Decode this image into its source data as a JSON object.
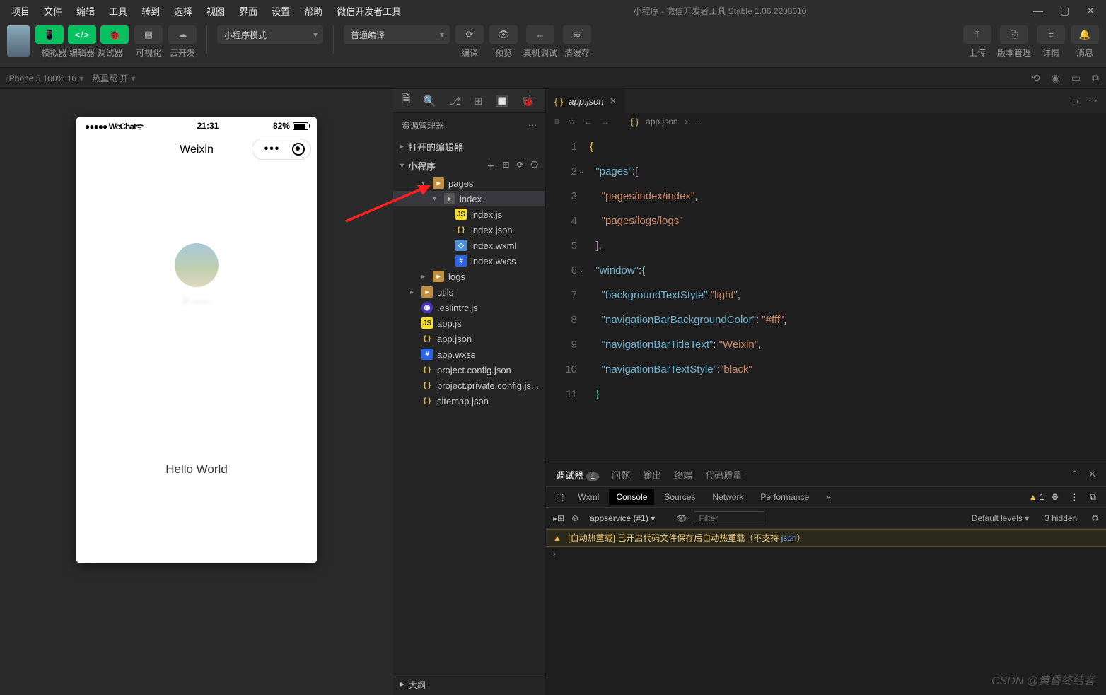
{
  "titlebar": {
    "menus": [
      "项目",
      "文件",
      "编辑",
      "工具",
      "转到",
      "选择",
      "视图",
      "界面",
      "设置",
      "帮助",
      "微信开发者工具"
    ],
    "title": "小程序 - 微信开发者工具 Stable 1.06.2208010"
  },
  "toolbar": {
    "groups": [
      {
        "buttons": [
          "📱",
          "</>",
          "🐞"
        ],
        "label": "模拟器   编辑器   调试器"
      }
    ],
    "vis_col": {
      "icon": "▦",
      "label": "可视化"
    },
    "cloud_col": {
      "icon": "☁",
      "label": "云开发"
    },
    "mode_select": "小程序模式",
    "compile_select": "普通编译",
    "compile_col": {
      "icon": "⟳",
      "label": "编译"
    },
    "preview_col": {
      "icon": "👁",
      "label": "预览"
    },
    "remote_col": {
      "icon": "⇔",
      "label": "真机调试"
    },
    "cache_col": {
      "icon": "≋",
      "label": "清缓存"
    },
    "upload_col": {
      "icon": "⤒",
      "label": "上传"
    },
    "version_col": {
      "icon": "⎘",
      "label": "版本管理"
    },
    "detail_col": {
      "icon": "≡",
      "label": "详情"
    },
    "msg_col": {
      "icon": "🔔",
      "label": "消息"
    }
  },
  "substatus": {
    "device": "iPhone 5 100% 16",
    "hot": "热重载 开",
    "icons": [
      "⟲",
      "◉",
      "▭",
      "⧉"
    ]
  },
  "explorer": {
    "strip_icons": [
      "🗎",
      "🔍",
      "⎇",
      "⊞",
      "🔲",
      "🐞"
    ],
    "title": "资源管理器",
    "section_open": "打开的编辑器",
    "project": "小程序",
    "proj_actions": [
      "＋",
      "⊞",
      "⟳",
      "⎔"
    ],
    "tree": [
      {
        "depth": 1,
        "exp": "▾",
        "icon": "fi-folder",
        "name": "pages"
      },
      {
        "depth": 2,
        "exp": "▾",
        "icon": "fi-folder-open",
        "name": "index",
        "sel": true
      },
      {
        "depth": 3,
        "icon": "fi-js",
        "name": "index.js"
      },
      {
        "depth": 3,
        "icon": "fi-json",
        "name": "index.json"
      },
      {
        "depth": 3,
        "icon": "fi-wxml",
        "name": "index.wxml"
      },
      {
        "depth": 3,
        "icon": "fi-wxss",
        "name": "index.wxss"
      },
      {
        "depth": 1,
        "exp": "▸",
        "icon": "fi-folder",
        "name": "logs"
      },
      {
        "depth": 0,
        "exp": "▸",
        "icon": "fi-folder",
        "name": "utils"
      },
      {
        "depth": 0,
        "icon": "fi-eslint",
        "name": ".eslintrc.js"
      },
      {
        "depth": 0,
        "icon": "fi-js",
        "name": "app.js"
      },
      {
        "depth": 0,
        "icon": "fi-json",
        "name": "app.json"
      },
      {
        "depth": 0,
        "icon": "fi-wxss",
        "name": "app.wxss"
      },
      {
        "depth": 0,
        "icon": "fi-json",
        "name": "project.config.json"
      },
      {
        "depth": 0,
        "icon": "fi-json",
        "name": "project.private.config.js..."
      },
      {
        "depth": 0,
        "icon": "fi-json",
        "name": "sitemap.json"
      }
    ],
    "outline": "大纲"
  },
  "simulator": {
    "carrier": "●●●●● WeChat",
    "wifi": "ᯤ",
    "time": "21:31",
    "battery": "82%",
    "nav_title": "Weixin",
    "hello": "Hello World"
  },
  "editor": {
    "head_tools_left": [
      "≡",
      "☆",
      "←",
      "→"
    ],
    "tab": {
      "icon": "{ }",
      "name": "app.json"
    },
    "right_tools": [
      "▭",
      "⋯"
    ],
    "breadcrumb": {
      "icon": "{ }",
      "file": "app.json",
      "more": "..."
    },
    "code": [
      {
        "n": 1,
        "html": "<span class='tok-brace'>{</span>"
      },
      {
        "n": 2,
        "fold": "⌄",
        "html": "  <span class='tok-key'>\"pages\"</span><span class='tok-punc'>:</span><span class='tok-bracket'>[</span>"
      },
      {
        "n": 3,
        "html": "    <span class='tok-str'>\"pages/index/index\"</span><span class='tok-punc'>,</span>"
      },
      {
        "n": 4,
        "html": "    <span class='tok-str'>\"pages/logs/logs\"</span>"
      },
      {
        "n": 5,
        "html": "  <span class='tok-bracket'>]</span><span class='tok-punc'>,</span>"
      },
      {
        "n": 6,
        "fold": "⌄",
        "html": "  <span class='tok-key'>\"window\"</span><span class='tok-punc'>:</span><span class='tok-bracket2'>{</span>"
      },
      {
        "n": 7,
        "html": "    <span class='tok-key'>\"backgroundTextStyle\"</span><span class='tok-punc'>:</span><span class='tok-str'>\"light\"</span><span class='tok-punc'>,</span>"
      },
      {
        "n": 8,
        "html": "    <span class='tok-key'>\"navigationBarBackgroundColor\"</span><span class='tok-punc'>: </span><span class='tok-str'>\"#fff\"</span><span class='tok-punc'>,</span>"
      },
      {
        "n": 9,
        "html": "    <span class='tok-key'>\"navigationBarTitleText\"</span><span class='tok-punc'>: </span><span class='tok-str'>\"Weixin\"</span><span class='tok-punc'>,</span>"
      },
      {
        "n": 10,
        "html": "    <span class='tok-key'>\"navigationBarTextStyle\"</span><span class='tok-punc'>:</span><span class='tok-str'>\"black\"</span>"
      },
      {
        "n": 11,
        "html": "  <span class='tok-bracket2'>}</span>"
      }
    ]
  },
  "debugger": {
    "tabs": [
      "调试器",
      "问题",
      "输出",
      "终端",
      "代码质量"
    ],
    "tab_badge": "1",
    "devtools": [
      "Wxml",
      "Console",
      "Sources",
      "Network",
      "Performance"
    ],
    "devtools_more": "»",
    "warn_count": "1",
    "console": {
      "context": "appservice (#1)",
      "filter_ph": "Filter",
      "levels": "Default levels ▾",
      "hidden": "3 hidden",
      "warn": "[自动热重载] 已开启代码文件保存后自动热重载（不支持 ",
      "warn_mono": "json",
      "warn_tail": "）"
    }
  },
  "watermark": "CSDN @黄昏终结者"
}
